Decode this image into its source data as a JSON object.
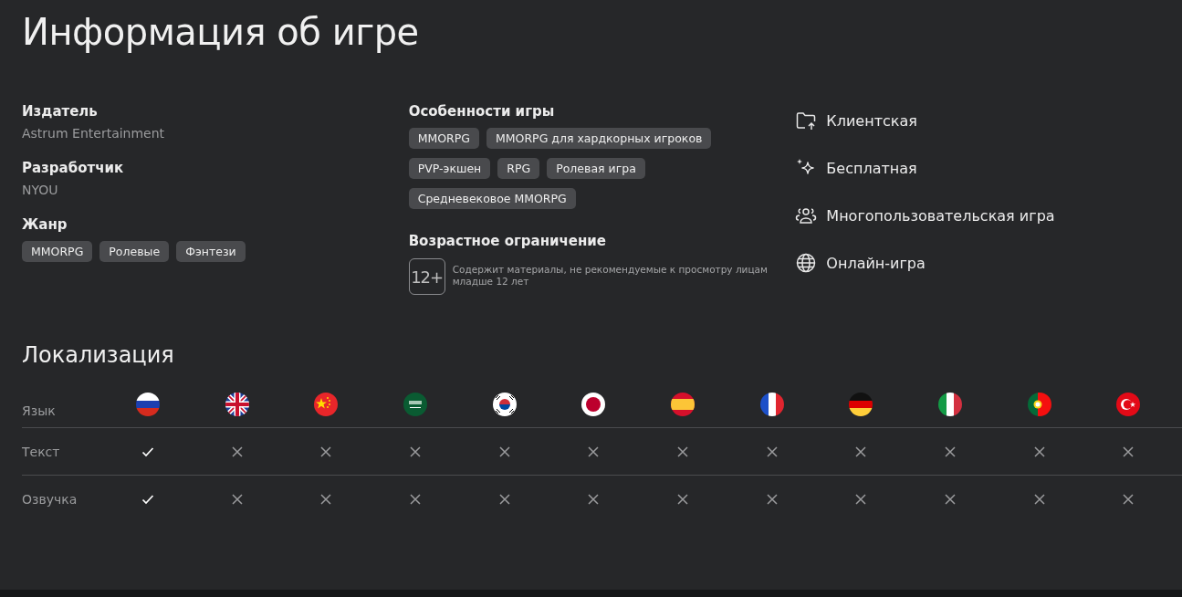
{
  "title": "Информация об игре",
  "info": [
    {
      "label": "Издатель",
      "value": "Astrum Entertainment"
    },
    {
      "label": "Разработчик",
      "value": "NYOU"
    }
  ],
  "genre": {
    "label": "Жанр",
    "tags": [
      "MMORPG",
      "Ролевые",
      "Фэнтези"
    ]
  },
  "features": {
    "label": "Особенности игры",
    "tags": [
      "MMORPG",
      "MMORPG для хардкорных игроков",
      "PVP-экшен",
      "RPG",
      "Ролевая игра",
      "Средневековое MMORPG"
    ]
  },
  "age_rating": {
    "label": "Возрастное ограничение",
    "badge": "12+",
    "description": "Содержит материалы, не рекомендуемые к просмотру лицам младше 12 лет"
  },
  "attributes": [
    {
      "kind": "client",
      "label": "Клиентская"
    },
    {
      "kind": "free",
      "label": "Бесплатная"
    },
    {
      "kind": "multiplayer",
      "label": "Многопользовательская игра"
    },
    {
      "kind": "online",
      "label": "Онлайн-игра"
    }
  ],
  "localization": {
    "title": "Локализация",
    "language_label": "Язык",
    "text_label": "Текст",
    "voice_label": "Озвучка",
    "languages": [
      {
        "kind": "ru",
        "text": true,
        "voice": true
      },
      {
        "kind": "gb",
        "text": false,
        "voice": false
      },
      {
        "kind": "cn",
        "text": false,
        "voice": false
      },
      {
        "kind": "sa",
        "text": false,
        "voice": false
      },
      {
        "kind": "kr",
        "text": false,
        "voice": false
      },
      {
        "kind": "jp",
        "text": false,
        "voice": false
      },
      {
        "kind": "es",
        "text": false,
        "voice": false
      },
      {
        "kind": "fr",
        "text": false,
        "voice": false
      },
      {
        "kind": "de",
        "text": false,
        "voice": false
      },
      {
        "kind": "it",
        "text": false,
        "voice": false
      },
      {
        "kind": "pt",
        "text": false,
        "voice": false
      },
      {
        "kind": "tr",
        "text": false,
        "voice": false
      }
    ]
  }
}
